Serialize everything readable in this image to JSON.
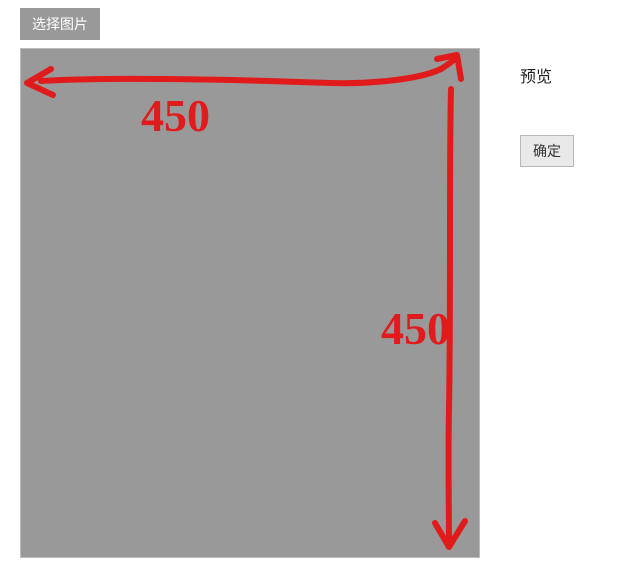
{
  "buttons": {
    "select_image": "选择图片",
    "confirm": "确定"
  },
  "labels": {
    "preview": "预览"
  },
  "annotations": {
    "width_value": "450",
    "height_value": "450"
  },
  "colors": {
    "annotation_stroke": "#e11b1b",
    "canvas_bg": "#999999",
    "select_btn_bg": "#999999"
  }
}
